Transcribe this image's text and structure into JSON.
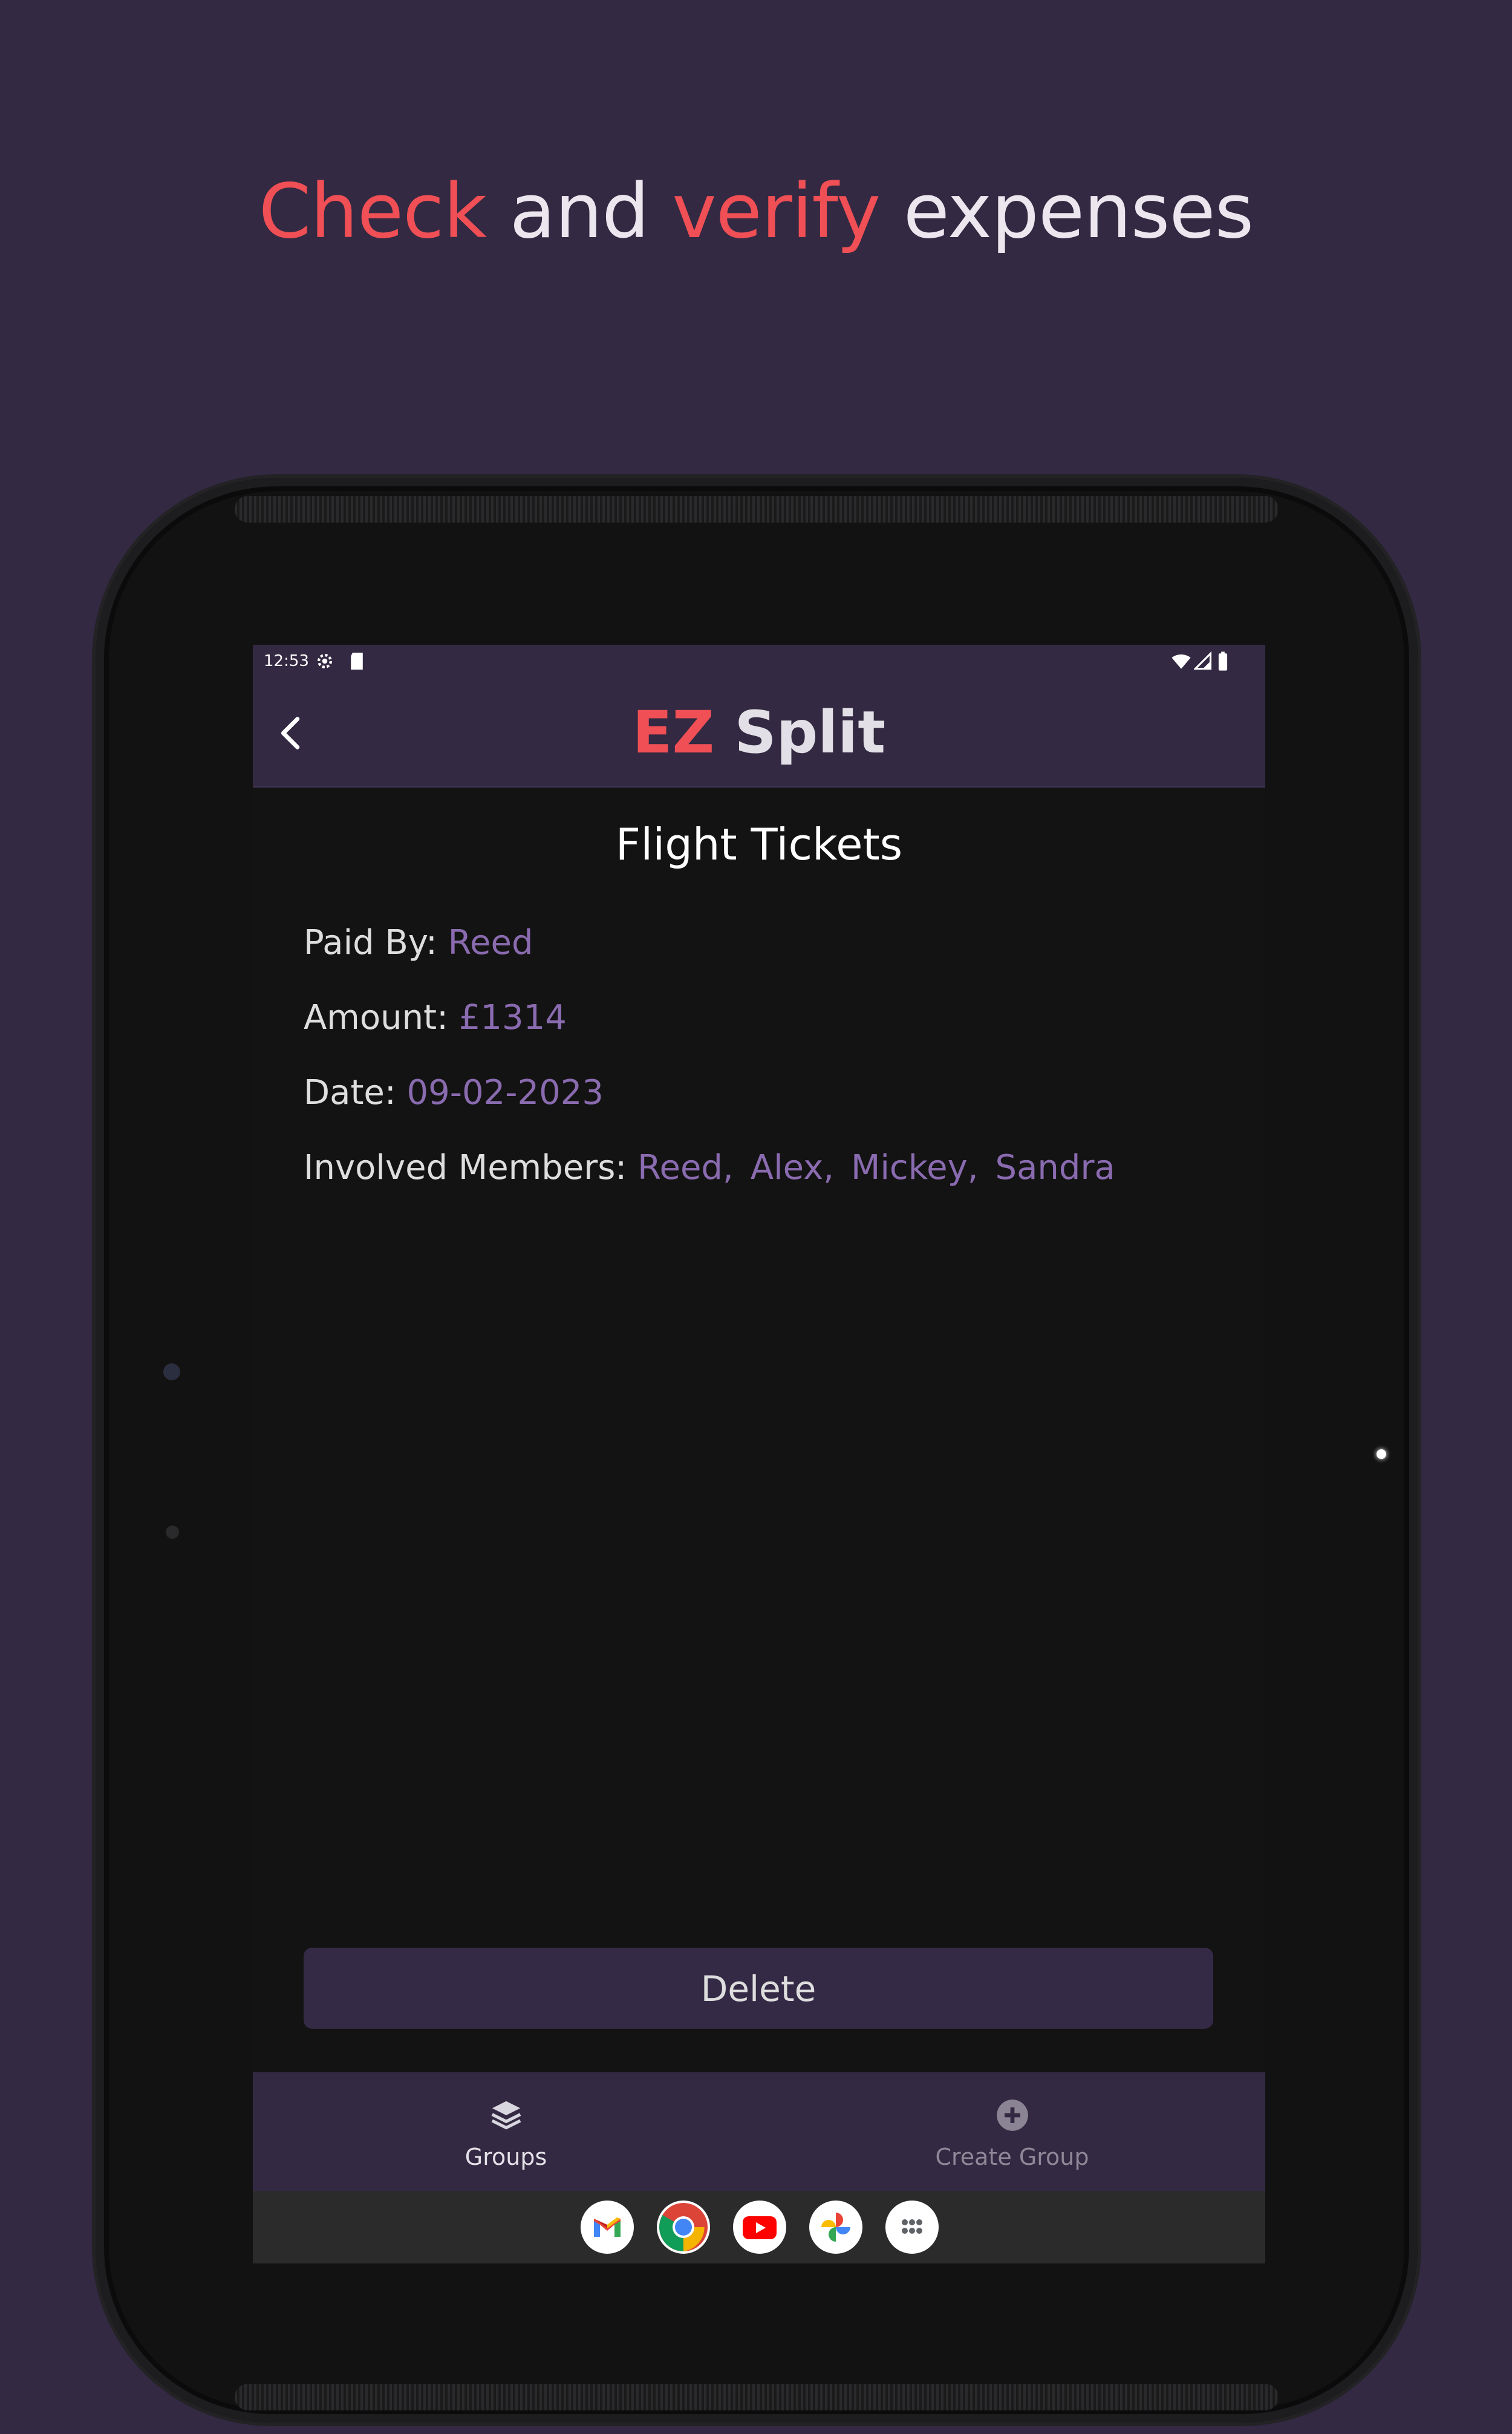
{
  "headline": {
    "word1": "Check",
    "word2": " and ",
    "word3": "verify",
    "word4": " expenses"
  },
  "statusbar": {
    "time": "12:53",
    "icons": [
      "settings-gear-icon",
      "sd-card-icon",
      "wifi-icon",
      "cell-signal-icon",
      "battery-icon"
    ]
  },
  "appbar": {
    "title_part1": "EZ",
    "title_part2": " Split",
    "back_icon": "chevron-left-icon"
  },
  "expense": {
    "title": "Flight Tickets",
    "paid_by_label": "Paid By: ",
    "paid_by_value": "Reed",
    "amount_label": "Amount: ",
    "amount_value": "£1314",
    "date_label": "Date: ",
    "date_value": "09-02-2023",
    "members_label": "Involved Members: ",
    "members": [
      "Reed,",
      "Alex,",
      "Mickey,",
      "Sandra"
    ]
  },
  "actions": {
    "delete_label": "Delete"
  },
  "bottom_nav": {
    "items": [
      {
        "label": "Groups",
        "icon": "layers-icon",
        "active": true
      },
      {
        "label": "Create Group",
        "icon": "plus-circle-icon",
        "active": false
      }
    ]
  },
  "dock": {
    "apps": [
      "gmail-icon",
      "chrome-icon",
      "youtube-icon",
      "photos-icon",
      "app-drawer-icon"
    ]
  },
  "colors": {
    "background": "#332942",
    "accent_red": "#ef4f55",
    "value_purple": "#8a6bb0",
    "screen_bg": "#131313"
  }
}
